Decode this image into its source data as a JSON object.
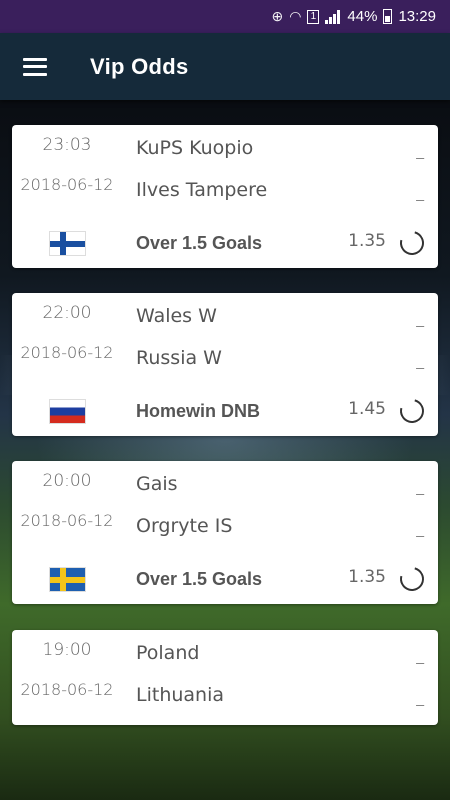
{
  "status_bar": {
    "battery": "44%",
    "time": "13:29",
    "sim_label": "1"
  },
  "app_bar": {
    "title": "Vip Odds",
    "background": "#152a3a"
  },
  "matches": [
    {
      "time": "23:03",
      "date": "2018-06-12",
      "home": "KuPS Kuopio",
      "away": "Ilves Tampere",
      "home_score": "_",
      "away_score": "_",
      "flag": "finland-flag-icon",
      "tip": "Over 1.5 Goals",
      "odds": "1.35",
      "status": "pending-icon"
    },
    {
      "time": "22:00",
      "date": "2018-06-12",
      "home": "Wales W",
      "away": "Russia W",
      "home_score": "_",
      "away_score": "_",
      "flag": "russia-flag-icon",
      "tip": "Homewin DNB",
      "odds": "1.45",
      "status": "pending-icon"
    },
    {
      "time": "20:00",
      "date": "2018-06-12",
      "home": "Gais",
      "away": "Orgryte IS",
      "home_score": "_",
      "away_score": "_",
      "flag": "sweden-flag-icon",
      "tip": "Over 1.5 Goals",
      "odds": "1.35",
      "status": "pending-icon"
    },
    {
      "time": "19:00",
      "date": "2018-06-12",
      "home": "Poland",
      "away": "Lithuania",
      "home_score": "_",
      "away_score": "_"
    }
  ]
}
